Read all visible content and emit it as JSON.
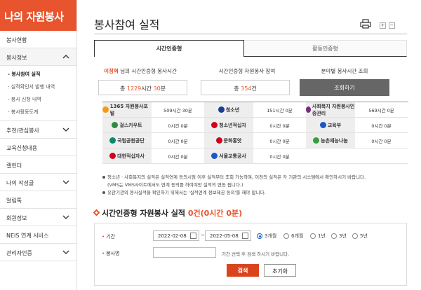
{
  "sidebar": {
    "title": "나의 자원봉사",
    "menu": [
      {
        "label": "봉사현황"
      },
      {
        "label": "봉사정보"
      },
      {
        "label": "추천/관심봉사"
      },
      {
        "label": "교육신청내용"
      },
      {
        "label": "캘린더"
      },
      {
        "label": "나의 작성글"
      },
      {
        "label": "알림톡"
      },
      {
        "label": "회원정보"
      },
      {
        "label": "NEIS 연계 서비스"
      },
      {
        "label": "관리자인증"
      }
    ],
    "submenu": [
      {
        "label": "- 봉사참여 실적"
      },
      {
        "label": "- 실적확인서 발행 내역"
      },
      {
        "label": "- 봉사 신청 내역"
      },
      {
        "label": "- 봉사활동도계"
      }
    ]
  },
  "page": {
    "title": "봉사참여 실적",
    "zoom_in": "+",
    "zoom_out": "−"
  },
  "tabs": {
    "time": "시간인증형",
    "activity": "활동인증형"
  },
  "summary": {
    "user_name": "이정혁",
    "user_suffix": " 님의 시간인증형 봉사시간",
    "count_label": "시간인증형 자원봉사 참여",
    "field_label": "분야별 봉사시간 조회",
    "total_prefix": "총 ",
    "total_hours": "1229",
    "hours_unit": "시간 ",
    "total_minutes": "30",
    "minutes_unit": "분",
    "count_prefix": "총 ",
    "count_value": "354",
    "count_unit": "건",
    "view_button": "조회하기"
  },
  "orgs": [
    {
      "logo": "1365 자원봉사포털",
      "value": "509시간 30분",
      "color": "#f39c12"
    },
    {
      "logo": "청소년",
      "value": "151시간 0분",
      "color": "#1a3d8f"
    },
    {
      "logo": "사회복지 자원봉사인증관리",
      "value": "569시간 0분",
      "color": "#7b2a7d"
    },
    {
      "logo": "걸스카우트",
      "value": "0시간 0분",
      "color": "#2e8b3e"
    },
    {
      "logo": "청소년적십자",
      "value": "0시간 0분",
      "color": "#d0021b"
    },
    {
      "logo": "교육부",
      "value": "0시간 0분",
      "color": "#1b57c6"
    },
    {
      "logo": "국립공원공단",
      "value": "0시간 0분",
      "color": "#0b8a6a"
    },
    {
      "logo": "문화홍앗",
      "value": "0시간 0분",
      "color": "#d0021b"
    },
    {
      "logo": "농촌재능나눔",
      "value": "0시간 0분",
      "color": "#3a9c3a"
    },
    {
      "logo": "대한적십자사",
      "value": "0시간 0분",
      "color": "#d0021b"
    },
    {
      "logo": "서울교통공사",
      "value": "0시간 0분",
      "color": "#1b57c6"
    }
  ],
  "notes": [
    "청소년 · 사회복지의 실적은 실적연계 동의시점 이후 실적부터 조회 가능하며, 이전의 실적은 각 기관의 시스템에서 확인하시기 바랍니다.",
    "(VMS는 VMS사이트에서도 연계 동의를 하여야만 실적의 연동 됩니다.)",
    "유관기관의 봉사실적을 확인하기 위해서는 '실적연계 정보제공 동의'를 해야 합니다."
  ],
  "section": {
    "title": "시간인증형 자원봉사 실적 ",
    "result": "0건(0시간 0분)"
  },
  "search": {
    "period_label": "기간",
    "date_from": "2022-02-08",
    "date_to": "2022-05-08",
    "date_sep": "~",
    "options": [
      "3개월",
      "6개월",
      "1년",
      "3년",
      "5년"
    ],
    "selected": "3개월",
    "name_label": "봉사명",
    "name_value": "",
    "name_hint": "기간 선택 후 검색 하시기 바랍니다.",
    "search_button": "검색",
    "reset_button": "초기화"
  },
  "colors": {
    "accent": "#e8542d",
    "button_dark": "#666666",
    "search_button": "#d9441d"
  }
}
